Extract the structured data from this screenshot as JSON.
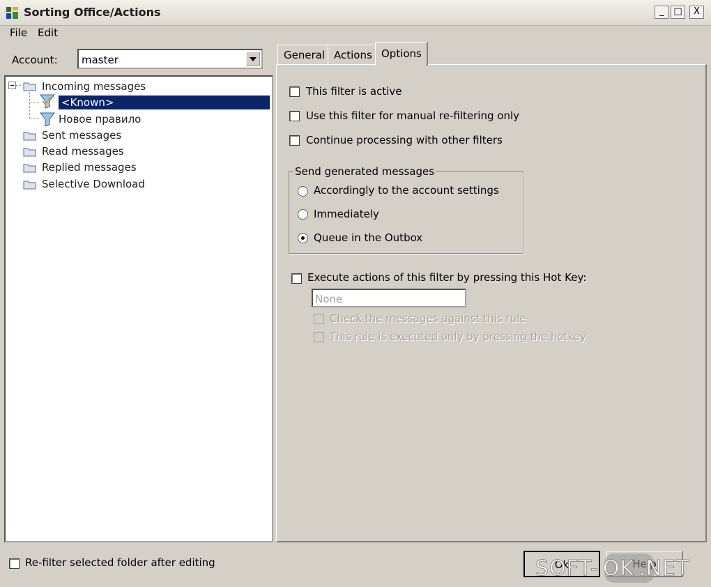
{
  "window": {
    "title": "Sorting Office/Actions",
    "controls": [
      "_",
      "□",
      "X"
    ]
  },
  "menu": {
    "items": [
      {
        "label": "File"
      },
      {
        "label": "Edit"
      }
    ]
  },
  "account": {
    "label": "Account:",
    "value": "master"
  },
  "tree": {
    "items": [
      {
        "label": "Incoming messages",
        "expanded": true
      },
      {
        "label": "<Known>",
        "selected": true
      },
      {
        "label": "Новое правило"
      },
      {
        "label": "Sent messages"
      },
      {
        "label": "Read messages"
      },
      {
        "label": "Replied messages"
      },
      {
        "label": "Selective Download"
      }
    ]
  },
  "tabs": [
    {
      "label": "General"
    },
    {
      "label": "Actions"
    },
    {
      "label": "Options",
      "active": true
    }
  ],
  "options": {
    "filter_active": {
      "label": "This filter is active",
      "checked": false
    },
    "manual_only": {
      "label": "Use this filter for manual re-filtering only",
      "checked": false
    },
    "continue_processing": {
      "label": "Continue processing with other filters",
      "checked": false
    },
    "send_group": {
      "title": "Send generated messages",
      "choices": [
        {
          "label": "Accordingly to the account settings",
          "selected": false
        },
        {
          "label": "Immediately",
          "selected": false
        },
        {
          "label": "Queue in the Outbox",
          "selected": true
        }
      ]
    },
    "hotkey": {
      "label": "Execute actions of this filter by pressing this Hot Key:",
      "checked": false,
      "value": "None",
      "check_rule_label": "Check the messages against this rule",
      "hotkey_only_label": "This rule is executed only by pressing the hotkey"
    }
  },
  "footer": {
    "refilter_label": "Re-filter selected folder after editing",
    "refilter_checked": false,
    "ok_label": "Ok",
    "help_label": "Help"
  },
  "watermark": {
    "left": "SOFT-",
    "middle": "OK",
    "right": ".NET"
  },
  "colors": {
    "selection": "#0a246a",
    "window_bg": "#d4d0c8"
  }
}
